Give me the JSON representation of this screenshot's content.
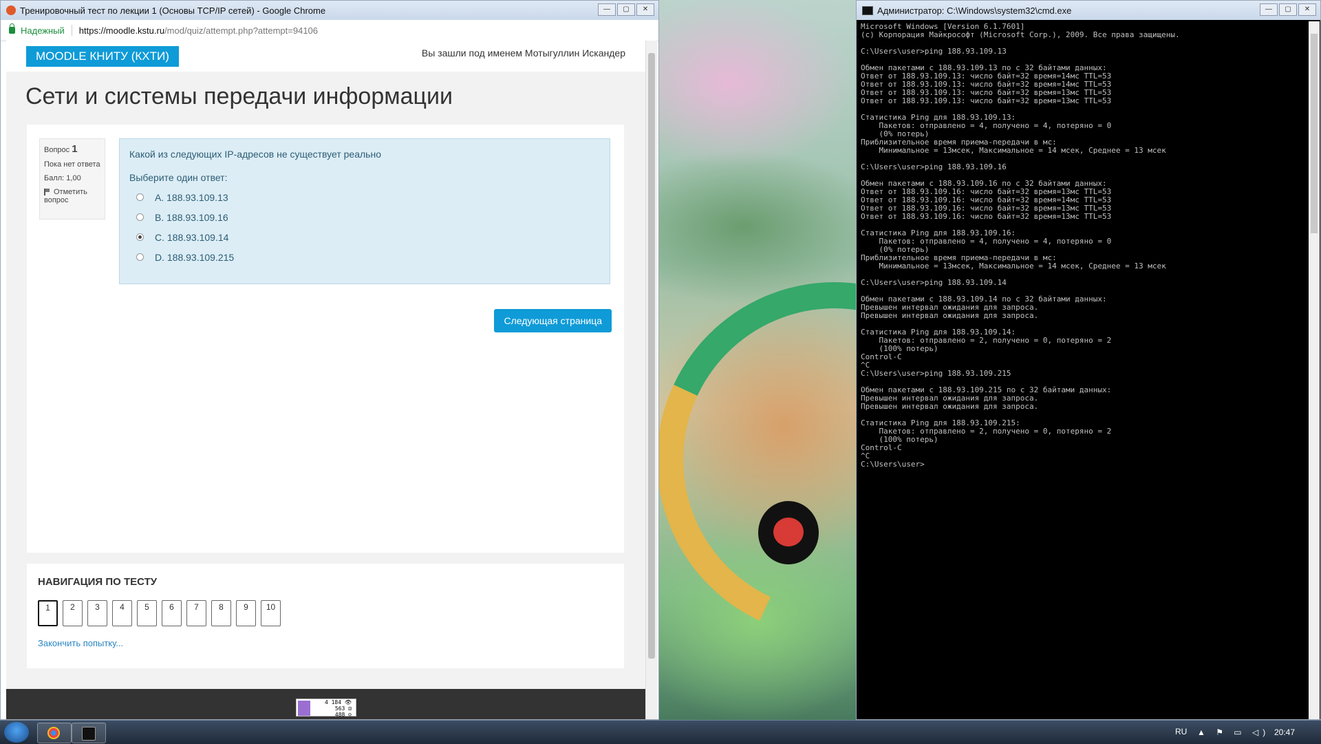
{
  "chrome": {
    "title": "Тренировочный тест по лекции 1 (Основы TCP/IP сетей) - Google Chrome",
    "secure_label": "Надежный",
    "url_host": "https://moodle.kstu.ru",
    "url_path": "/mod/quiz/attempt.php?attempt=94106"
  },
  "moodle": {
    "brand": "MOODLE КНИТУ (КХТИ)",
    "login_info": "Вы зашли под именем Мотыгуллин Искандер",
    "course_title": "Сети и системы передачи информации",
    "qinfo": {
      "label": "Вопрос",
      "number": "1",
      "status": "Пока нет ответа",
      "grade": "Балл: 1,00",
      "flag": "Отметить вопрос"
    },
    "question": {
      "text": "Какой из следующих IP-адресов не существует реально",
      "prompt": "Выберите один ответ:",
      "answers": [
        {
          "label": "A. 188.93.109.13",
          "selected": false
        },
        {
          "label": "B. 188.93.109.16",
          "selected": false
        },
        {
          "label": "C. 188.93.109.14",
          "selected": true
        },
        {
          "label": "D. 188.93.109.215",
          "selected": false
        }
      ]
    },
    "next_button": "Следующая страница",
    "nav": {
      "title": "НАВИГАЦИЯ ПО ТЕСТУ",
      "numbers": [
        "1",
        "2",
        "3",
        "4",
        "5",
        "6",
        "7",
        "8",
        "9",
        "10"
      ],
      "current": "1",
      "finish": "Закончить попытку..."
    },
    "counter_lines": [
      "4 184 👁",
      "563 ⊡",
      "488 ☺"
    ]
  },
  "cmd": {
    "title": "Администратор: C:\\Windows\\system32\\cmd.exe",
    "lines": [
      "Microsoft Windows [Version 6.1.7601]",
      "(c) Корпорация Майкрософт (Microsoft Corp.), 2009. Все права защищены.",
      "",
      "C:\\Users\\user>ping 188.93.109.13",
      "",
      "Обмен пакетами с 188.93.109.13 по с 32 байтами данных:",
      "Ответ от 188.93.109.13: число байт=32 время=14мс TTL=53",
      "Ответ от 188.93.109.13: число байт=32 время=14мс TTL=53",
      "Ответ от 188.93.109.13: число байт=32 время=13мс TTL=53",
      "Ответ от 188.93.109.13: число байт=32 время=13мс TTL=53",
      "",
      "Статистика Ping для 188.93.109.13:",
      "    Пакетов: отправлено = 4, получено = 4, потеряно = 0",
      "    (0% потерь)",
      "Приблизительное время приема-передачи в мс:",
      "    Минимальное = 13мсек, Максимальное = 14 мсек, Среднее = 13 мсек",
      "",
      "C:\\Users\\user>ping 188.93.109.16",
      "",
      "Обмен пакетами с 188.93.109.16 по с 32 байтами данных:",
      "Ответ от 188.93.109.16: число байт=32 время=13мс TTL=53",
      "Ответ от 188.93.109.16: число байт=32 время=14мс TTL=53",
      "Ответ от 188.93.109.16: число байт=32 время=13мс TTL=53",
      "Ответ от 188.93.109.16: число байт=32 время=13мс TTL=53",
      "",
      "Статистика Ping для 188.93.109.16:",
      "    Пакетов: отправлено = 4, получено = 4, потеряно = 0",
      "    (0% потерь)",
      "Приблизительное время приема-передачи в мс:",
      "    Минимальное = 13мсек, Максимальное = 14 мсек, Среднее = 13 мсек",
      "",
      "C:\\Users\\user>ping 188.93.109.14",
      "",
      "Обмен пакетами с 188.93.109.14 по с 32 байтами данных:",
      "Превышен интервал ожидания для запроса.",
      "Превышен интервал ожидания для запроса.",
      "",
      "Статистика Ping для 188.93.109.14:",
      "    Пакетов: отправлено = 2, получено = 0, потеряно = 2",
      "    (100% потерь)",
      "Control-C",
      "^C",
      "C:\\Users\\user>ping 188.93.109.215",
      "",
      "Обмен пакетами с 188.93.109.215 по с 32 байтами данных:",
      "Превышен интервал ожидания для запроса.",
      "Превышен интервал ожидания для запроса.",
      "",
      "Статистика Ping для 188.93.109.215:",
      "    Пакетов: отправлено = 2, получено = 0, потеряно = 2",
      "    (100% потерь)",
      "Control-C",
      "^C",
      "C:\\Users\\user>"
    ]
  },
  "taskbar": {
    "lang": "RU",
    "clock": "20:47",
    "tray_icons": [
      "up-arrow-icon",
      "flag-icon",
      "network-icon",
      "volume-icon"
    ]
  },
  "window_buttons": {
    "minimize": "—",
    "maximize": "▢",
    "close": "✕"
  }
}
